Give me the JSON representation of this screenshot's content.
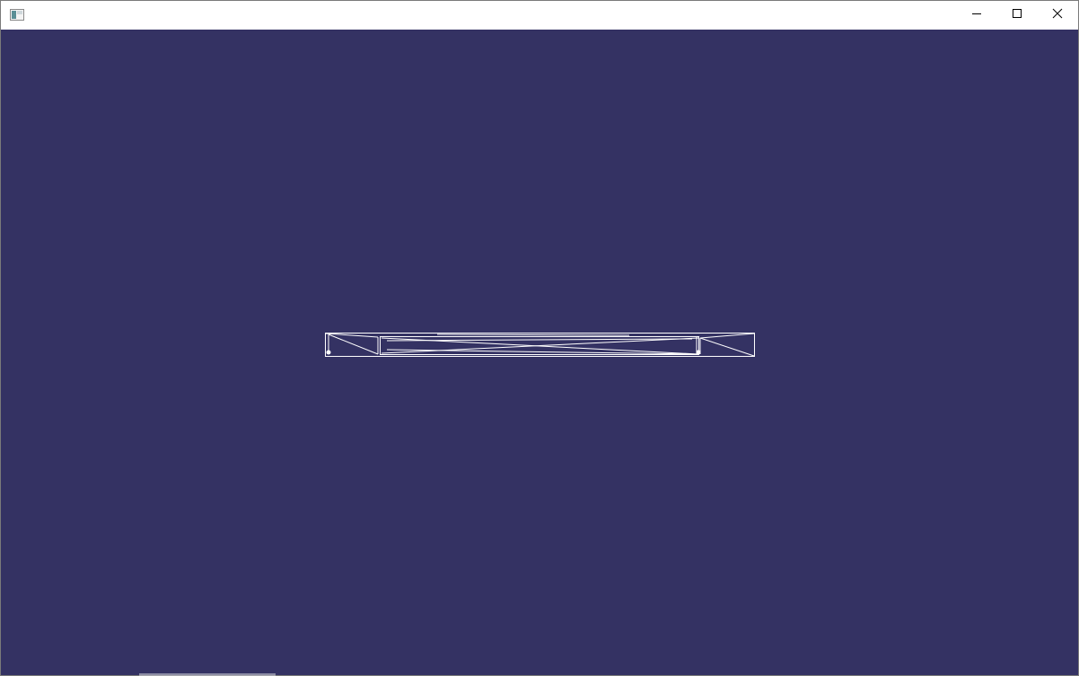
{
  "window": {
    "title": "",
    "icon": "app-window-icon",
    "controls": {
      "minimize_icon": "minimize-icon",
      "maximize_icon": "maximize-icon",
      "close_icon": "close-icon"
    }
  },
  "viewport": {
    "background_color": "#343263",
    "wireframe_color": "#ffffff",
    "content": "wireframe-mesh"
  }
}
